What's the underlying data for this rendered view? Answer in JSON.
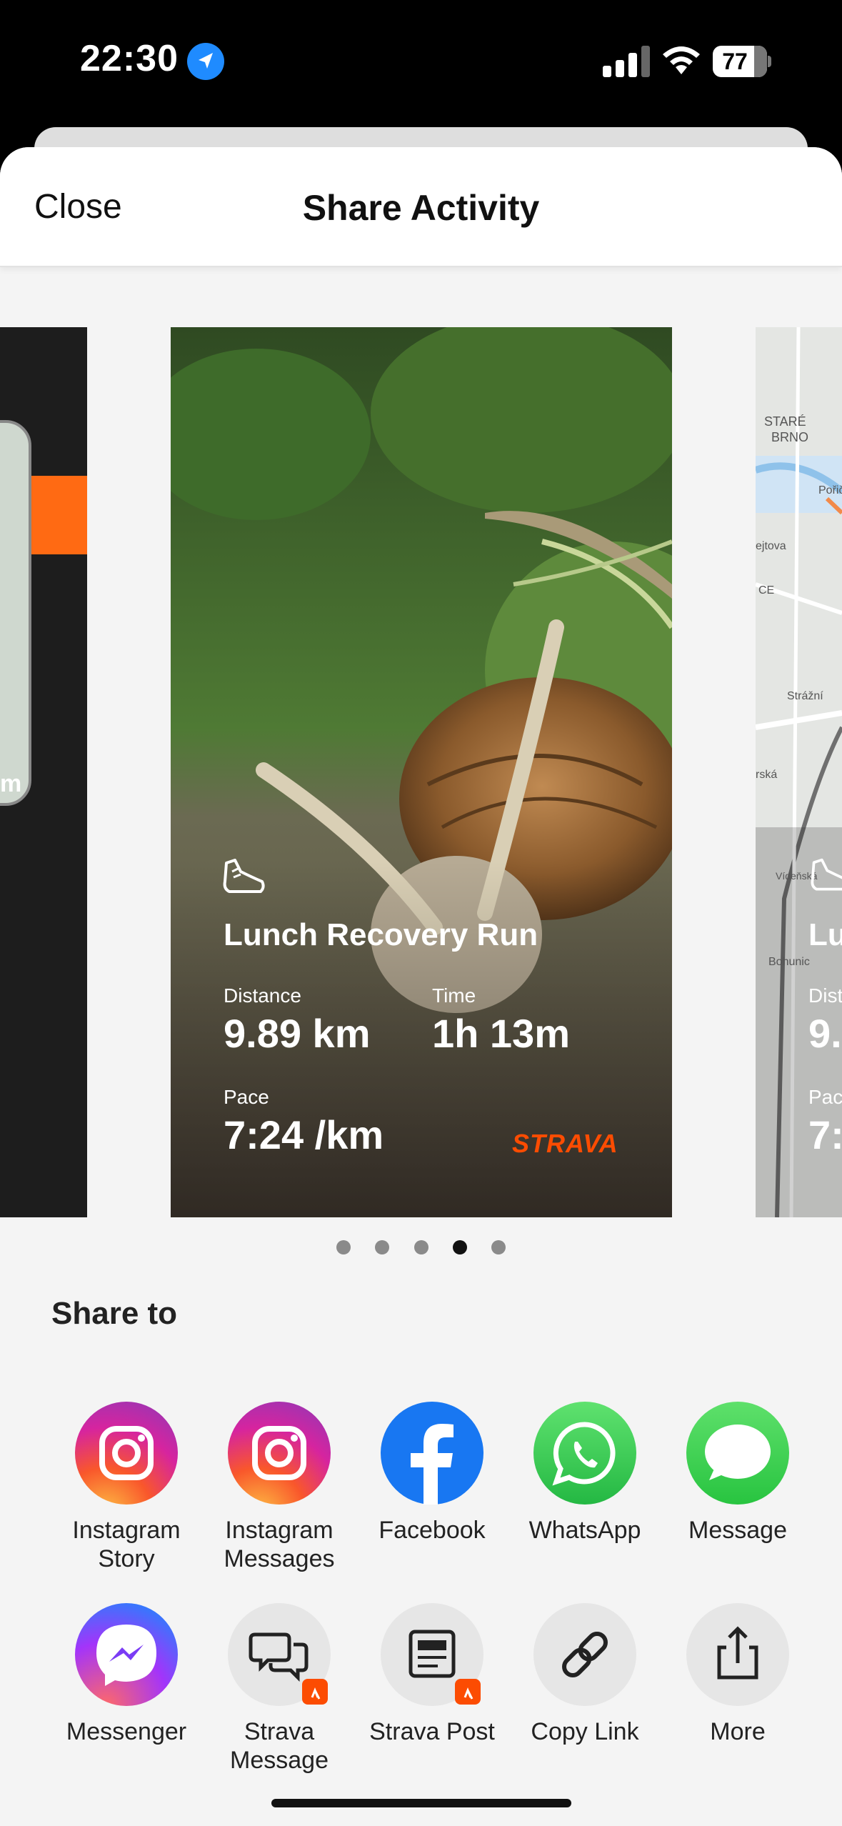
{
  "status_bar": {
    "time": "22:30",
    "battery": "77"
  },
  "nav": {
    "close_label": "Close",
    "title": "Share Activity"
  },
  "carousel": {
    "left_card_text": "m",
    "main_card": {
      "title": "Lunch Recovery Run",
      "stats": [
        {
          "label": "Distance",
          "value": "9.89 km"
        },
        {
          "label": "Time",
          "value": "1h 13m"
        },
        {
          "label": "Pace",
          "value": "7:24 /km"
        }
      ],
      "brand": "STRAVA"
    },
    "right_card": {
      "title_partial": "Lu",
      "dist_label_partial": "Dist",
      "dist_value_partial": "9.",
      "pace_label_partial": "Pac",
      "pace_value_partial": "7:",
      "map_labels": [
        "STARÉ",
        "BRNO",
        "Pořič",
        "ejtova",
        "CE",
        "Strážní",
        "rská",
        "Vídeňská",
        "Bohunic"
      ]
    },
    "page_count": 5,
    "active_page": 3
  },
  "share": {
    "title": "Share to",
    "items": [
      {
        "label": "Instagram Story",
        "icon": "instagram-icon"
      },
      {
        "label": "Instagram Messages",
        "icon": "instagram-icon"
      },
      {
        "label": "Facebook",
        "icon": "facebook-icon"
      },
      {
        "label": "WhatsApp",
        "icon": "whatsapp-icon"
      },
      {
        "label": "Message",
        "icon": "message-icon"
      },
      {
        "label": "Messenger",
        "icon": "messenger-icon"
      },
      {
        "label": "Strava Message",
        "icon": "strava-message-icon"
      },
      {
        "label": "Strava Post",
        "icon": "strava-post-icon"
      },
      {
        "label": "Copy Link",
        "icon": "link-icon"
      },
      {
        "label": "More",
        "icon": "share-upload-icon"
      }
    ]
  },
  "colors": {
    "strava_orange": "#fc4c02",
    "facebook_blue": "#1877f2",
    "whatsapp_green": "#25d366",
    "message_green": "#34c759"
  }
}
